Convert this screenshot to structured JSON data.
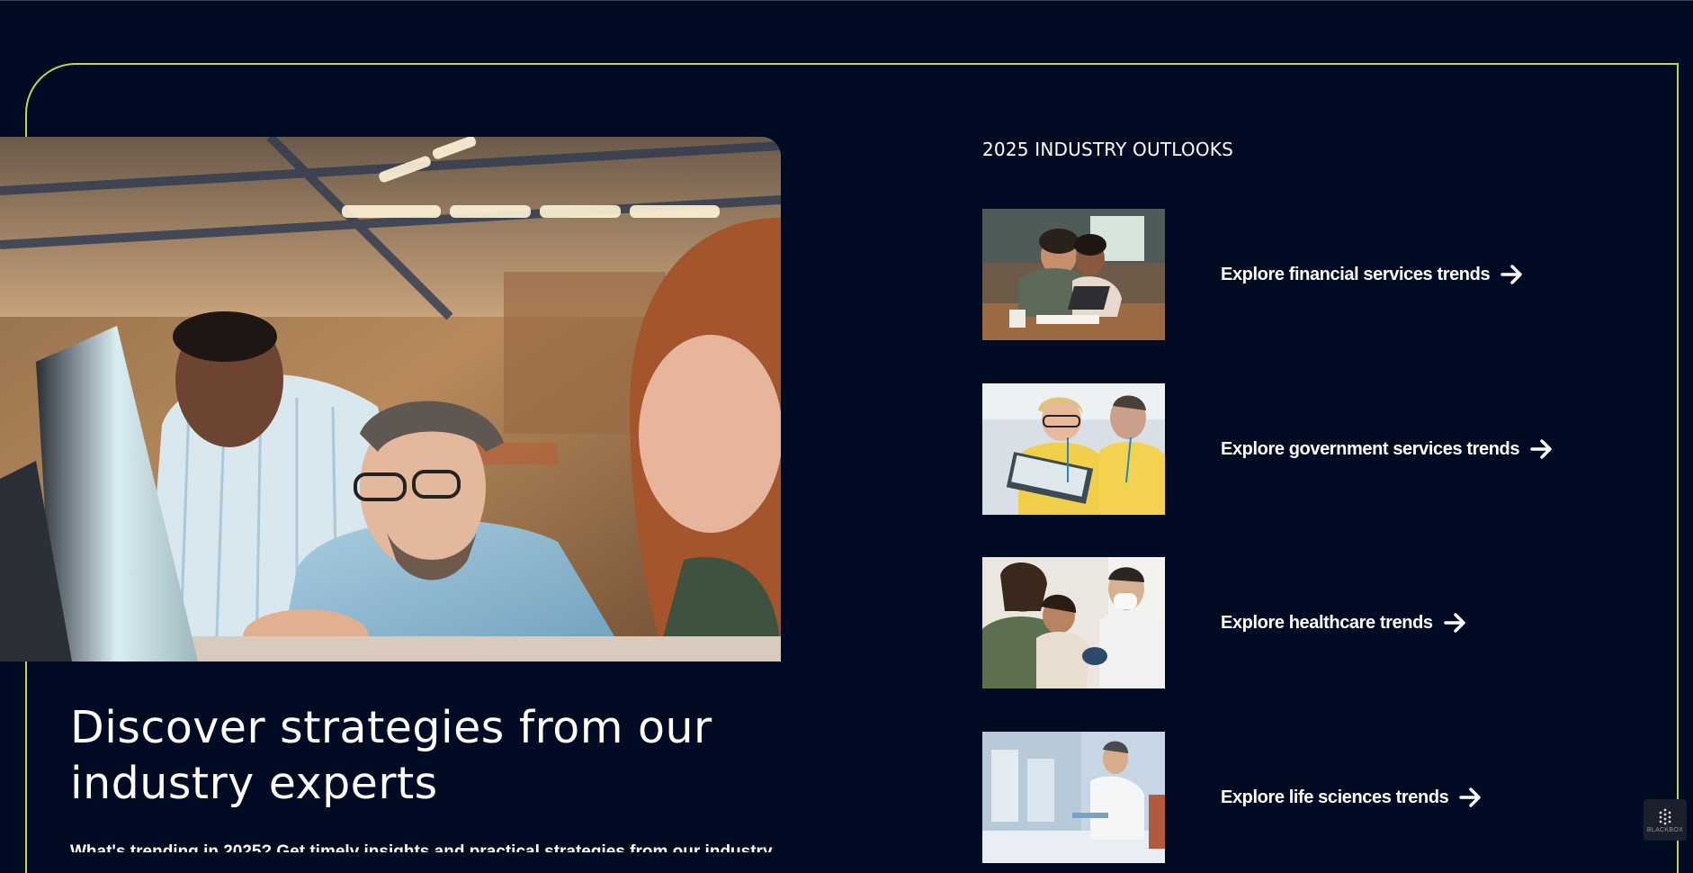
{
  "hero": {
    "image": "team-at-computer-photo",
    "headline": "Discover strategies from our industry experts",
    "subtext": "What's trending in 2025? Get timely insights and practical strategies from our industry"
  },
  "outlooks": {
    "title": "2025 INDUSTRY OUTLOOKS",
    "items": [
      {
        "label": "Explore financial services trends",
        "image": "couple-reviewing-finances-photo",
        "icon": "arrow-right-icon"
      },
      {
        "label": "Explore government services trends",
        "image": "volunteers-with-tablet-photo",
        "icon": "arrow-right-icon"
      },
      {
        "label": "Explore healthcare trends",
        "image": "doctor-with-mother-and-child-photo",
        "icon": "arrow-right-icon"
      },
      {
        "label": "Explore life sciences trends",
        "image": "lab-scientist-photo",
        "icon": "arrow-right-icon"
      }
    ]
  },
  "badge": {
    "label": "BLACKBOX",
    "icon": "blackbox-logo-icon"
  },
  "colors": {
    "background": "#020b24",
    "frame_accent": "#c6d44a",
    "text": "#ffffff"
  }
}
